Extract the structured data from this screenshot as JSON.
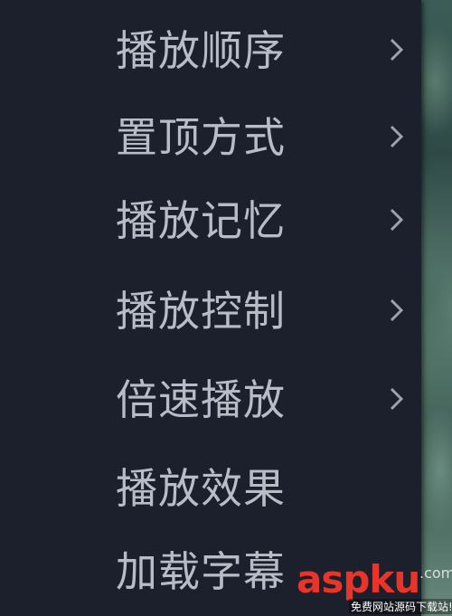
{
  "menu": {
    "items": [
      {
        "label": "播放顺序",
        "has_submenu": true
      },
      {
        "label": "置顶方式",
        "has_submenu": true
      },
      {
        "label": "播放记忆",
        "has_submenu": true
      },
      {
        "label": "播放控制",
        "has_submenu": true
      },
      {
        "label": "倍速播放",
        "has_submenu": true
      },
      {
        "label": "播放效果",
        "has_submenu": false
      },
      {
        "label": "加载字幕",
        "has_submenu": false
      }
    ],
    "submenu_icon": "chevron-right-icon"
  },
  "watermark": {
    "logo_part1": "asp",
    "logo_part2": "ku",
    "suffix": ".com",
    "tagline": "免费网站源码下载站!"
  },
  "colors": {
    "menu_background": "#1c1f2c",
    "menu_text": "#b8bcc6",
    "watermark_red": "#e8352a"
  }
}
